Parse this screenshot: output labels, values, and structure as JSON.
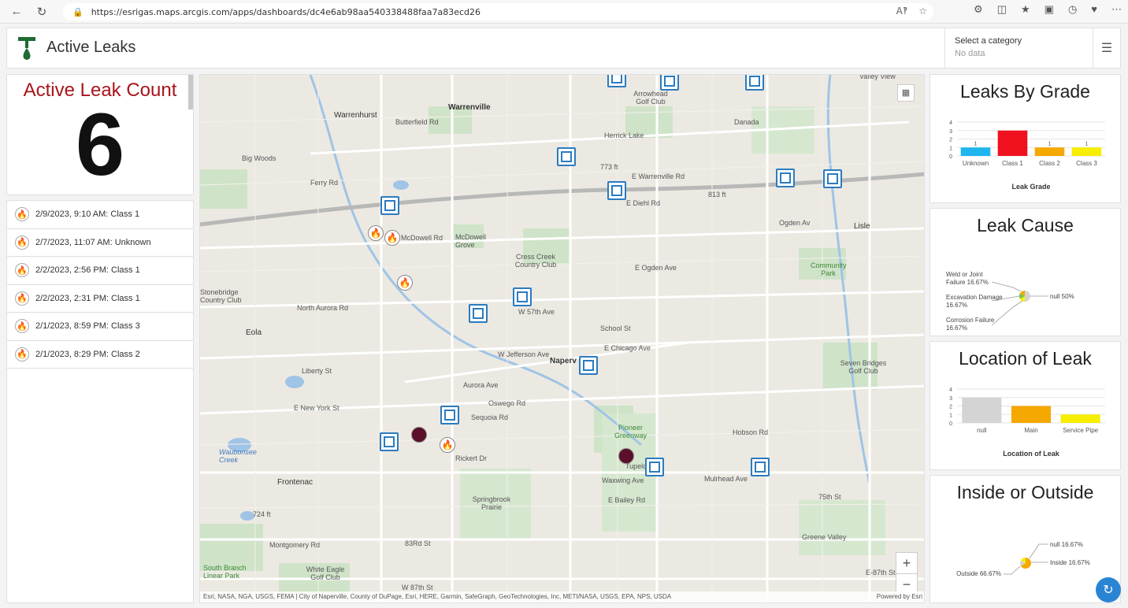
{
  "browser": {
    "url": "https://esrigas.maps.arcgis.com/apps/dashboards/dc4e6ab98aa540338488faa7a83ecd26"
  },
  "header": {
    "title": "Active Leaks",
    "category_label": "Select a category",
    "category_value": "No data"
  },
  "indicator": {
    "title": "Active Leak Count",
    "value": "6"
  },
  "leak_list": [
    {
      "text": "2/9/2023, 9:10 AM: Class 1",
      "icon": "flame-class1-icon",
      "color": "#b5121b"
    },
    {
      "text": "2/7/2023, 11:07 AM: Unknown",
      "icon": "flame-unknown-icon",
      "color": "#777777"
    },
    {
      "text": "2/2/2023, 2:56 PM: Class 1",
      "icon": "flame-class1-icon",
      "color": "#b5121b"
    },
    {
      "text": "2/2/2023, 2:31 PM: Class 1",
      "icon": "flame-class1-icon",
      "color": "#b5121b"
    },
    {
      "text": "2/1/2023, 8:59 PM: Class 3",
      "icon": "flame-class3-icon",
      "color": "#f5a800"
    },
    {
      "text": "2/1/2023, 8:29 PM: Class 2",
      "icon": "flame-class2-icon",
      "color": "#e8565c"
    }
  ],
  "map": {
    "labels": {
      "warrenville": "Warrenville",
      "warrenhurst": "Warrenhurst",
      "naperville": "Naperv",
      "lisle": "Lisle",
      "eola": "Eola",
      "frontenac": "Frontenac",
      "big_woods": "Big Woods",
      "danada": "Danada",
      "herrick_lake": "Herrick Lake",
      "arrowhead": "Arrowhead Golf Club",
      "mcdowell": "McDowell Grove",
      "cress_creek": "Cress Creek Country Club",
      "school_st": "School St",
      "community_park": "Community Park",
      "seven_bridges": "Seven Bridges Golf Club",
      "pioneer": "Pioneer Greenway",
      "springbrook": "Springbrook Prairie",
      "greene_valley": "Greene Valley",
      "white_eagle": "White Eagle Golf Club",
      "south_branch": "South Branch Linear Park",
      "waubonsee": "Waubonsee Creek",
      "stonebridge": "Stonebridge Country Club",
      "valley_view": "Valley View",
      "ogden": "Ogden Av",
      "e_ogden": "E Ogden Ave",
      "diehl": "E Diehl Rd",
      "warrenville_rd": "E Warrenville Rd",
      "chicago_ave": "E Chicago Ave",
      "jefferson": "W Jefferson Ave",
      "aurora": "North Aurora Rd",
      "aurora_ave": "Aurora Ave",
      "new_york": "E New York St",
      "hobson": "Hobson Rd",
      "tupelo": "Tupelo Ave",
      "waxwing": "Waxwing Ave",
      "mulrhead": "Mulrhead Ave",
      "bailey": "E Bailey Rd",
      "w75th": "75th St",
      "w83rd": "83Rd St",
      "w87th": "W 87th St",
      "montgomery": "Montgomery Rd",
      "rickert": "Rickert Dr",
      "sequoia": "Sequoia Rd",
      "fifty_seventh": "W 57th Ave",
      "oswego": "Oswego Rd",
      "butterfield": "Butterfield Rd",
      "mcdowell_rd": "McDowell Rd",
      "liberty": "Liberty St",
      "ferry": "Ferry Rd",
      "e87th": "E-87th St",
      "f773": "773 ft",
      "f813": "813 ft",
      "f724": "724 ft"
    },
    "attribution": "Esri, NASA, NGA, USGS, FEMA | City of Naperville, County of DuPage, Esri, HERE, Garmin, SafeGraph, GeoTechnologies, Inc, METI/NASA, USGS, EPA, NPS, USDA",
    "powered_by": "Powered by Esri",
    "zoom_in": "+",
    "zoom_out": "−"
  },
  "chart_data": [
    {
      "type": "bar",
      "title": "Leaks By Grade",
      "categories": [
        "Unknown",
        "Class 1",
        "Class 2",
        "Class 3"
      ],
      "values": [
        1,
        3,
        1,
        1
      ],
      "data_labels": [
        "1",
        "",
        "1",
        "1"
      ],
      "colors": [
        "#1fb6f0",
        "#f0111f",
        "#f5a800",
        "#f7ee00"
      ],
      "xlabel": "Leak Grade",
      "ylabel": "",
      "yticks": [
        "0",
        "1",
        "2",
        "3",
        "4"
      ],
      "ylim": [
        0,
        4
      ],
      "grid": true
    },
    {
      "type": "pie",
      "title": "Leak Cause",
      "slices": [
        {
          "label": "null",
          "value": 50,
          "display": "null 50%",
          "color": "#d4d4d4"
        },
        {
          "label": "Weld or Joint Failure",
          "value": 16.67,
          "display": "Weld or Joint Failure 16.67%",
          "color": "#f7ee00"
        },
        {
          "label": "Excavation Damage",
          "value": 16.67,
          "display": "Excavation Damage 16.67%",
          "color": "#74c043"
        },
        {
          "label": "Corrosion Failure",
          "value": 16.67,
          "display": "Corrosion Failure 16.67%",
          "color": "#f5a800"
        }
      ]
    },
    {
      "type": "bar",
      "title": "Location of Leak",
      "categories": [
        "null",
        "Main",
        "Service Pipe"
      ],
      "values": [
        3,
        2,
        1
      ],
      "colors": [
        "#d4d4d4",
        "#f5a800",
        "#f7ee00"
      ],
      "xlabel": "Location of Leak",
      "ylabel": "",
      "yticks": [
        "0",
        "1",
        "2",
        "3",
        "4"
      ],
      "ylim": [
        0,
        4
      ],
      "grid": true
    },
    {
      "type": "pie",
      "title": "Inside or Outside",
      "slices": [
        {
          "label": "Outside",
          "value": 66.67,
          "display": "Outside 66.67%",
          "color": "#f5a800"
        },
        {
          "label": "null",
          "value": 16.67,
          "display": "null 16.67%",
          "color": "#d4d4d4"
        },
        {
          "label": "Inside",
          "value": 16.67,
          "display": "Inside 16.67%",
          "color": "#f7ee00"
        }
      ]
    }
  ]
}
